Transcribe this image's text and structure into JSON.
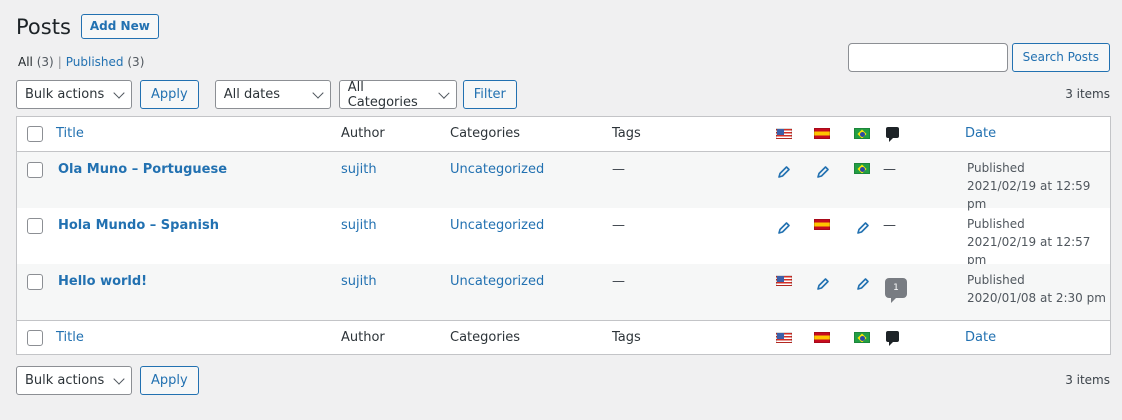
{
  "page": {
    "title": "Posts",
    "add_new": "Add New"
  },
  "views": {
    "all_label": "All",
    "all_count": "(3)",
    "separator": "|",
    "published_label": "Published",
    "published_count": "(3)"
  },
  "search": {
    "button": "Search Posts",
    "value": ""
  },
  "top_nav": {
    "bulk_actions": "Bulk actions",
    "apply": "Apply",
    "dates": "All dates",
    "categories": "All Categories",
    "filter": "Filter",
    "items_count": "3 items"
  },
  "bottom_nav": {
    "bulk_actions": "Bulk actions",
    "apply": "Apply",
    "items_count": "3 items"
  },
  "columns": {
    "title": "Title",
    "author": "Author",
    "categories": "Categories",
    "tags": "Tags",
    "date": "Date"
  },
  "language_flags": [
    "us",
    "es",
    "br"
  ],
  "colors": {
    "link": "#2271b1",
    "border": "#c3c4c7",
    "bg": "#f0f0f1"
  },
  "posts": [
    {
      "title": "Ola Muno – Portuguese",
      "author": "sujith",
      "category": "Uncategorized",
      "tags": "—",
      "langs": [
        "pencil-icon",
        "pencil-icon",
        "flag-br"
      ],
      "comments": "—",
      "status": "Published",
      "date": "2021/02/19 at 12:59 pm"
    },
    {
      "title": "Hola Mundo – Spanish",
      "author": "sujith",
      "category": "Uncategorized",
      "tags": "—",
      "langs": [
        "pencil-icon",
        "flag-es",
        "pencil-icon"
      ],
      "comments": "—",
      "status": "Published",
      "date": "2021/02/19 at 12:57 pm"
    },
    {
      "title": "Hello world!",
      "author": "sujith",
      "category": "Uncategorized",
      "tags": "—",
      "langs": [
        "flag-us",
        "pencil-icon",
        "pencil-icon"
      ],
      "comments": "1",
      "status": "Published",
      "date": "2020/01/08 at 2:30 pm"
    }
  ]
}
